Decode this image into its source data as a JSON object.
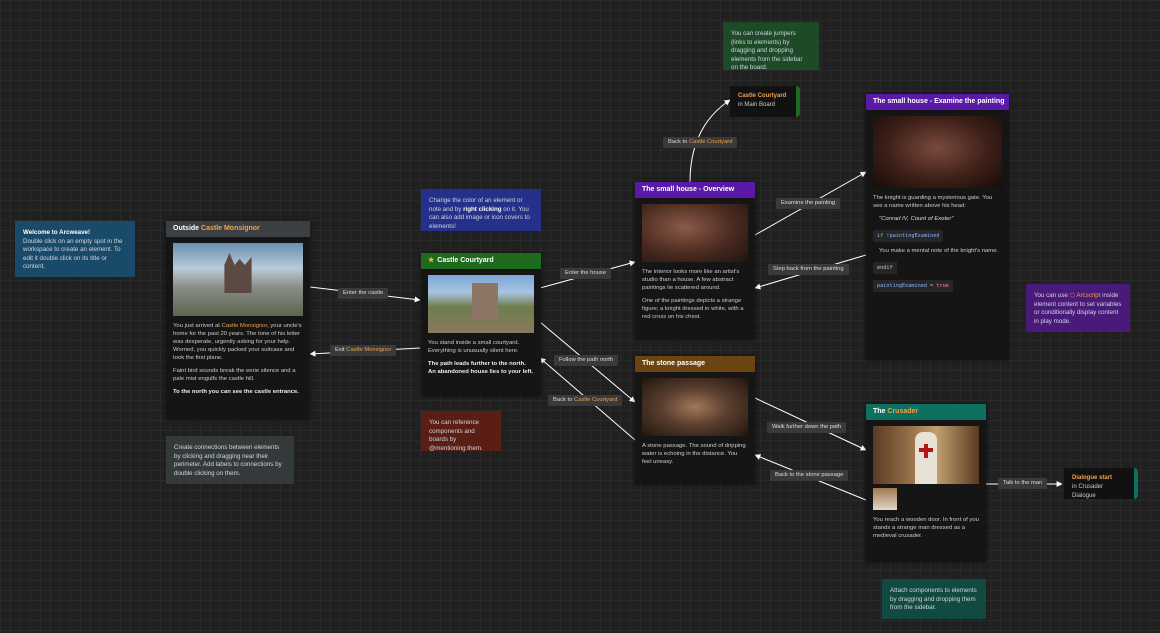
{
  "colors": {
    "canvas": "#202020",
    "accent_orange": "#f0a050",
    "header_dark": "#3b4043",
    "header_green": "#1e6b1e",
    "header_purple": "#5a1aa8",
    "header_brown": "#6b4412",
    "header_teal": "#0d7060",
    "note_blue": "#1a4a6a",
    "note_navy": "#24308a",
    "note_green": "#1e4a28",
    "note_red": "#5a1e14",
    "note_purple": "#4a1a7a",
    "note_grey": "#343a3a",
    "note_teal": "#104a40",
    "wire": "#ffffff"
  },
  "notes": {
    "welcome": {
      "title": "Welcome to Arcweave!",
      "body": "Double click on an empty spot in the workspace to create an element. To edit it double click on its title or content."
    },
    "jumpers": {
      "body": "You can create jumpers (links to elements) by dragging and dropping elements from the sidebar on the board."
    },
    "color": {
      "before": "Change the color of an element or note and by ",
      "bold": "right clicking",
      "after": " on it. You can also add image or icon covers to elements!"
    },
    "mention": {
      "body": "You can reference components and boards by @mentioning them."
    },
    "connections": {
      "body": "Create connections between elements by clicking and dragging near their perimeter. Add labels to connections by double clicking on them."
    },
    "arcscript": {
      "before": "You can use ",
      "icon": "arcscript-icon",
      "link": "Arcscript",
      "after": " inside element content to set variables or conditionally display content in play mode."
    },
    "components": {
      "body": "Attach components to elements by dragging and dropping them from the sidebar."
    }
  },
  "cards": {
    "outside": {
      "title_prefix": "Outside ",
      "title_highlight": "Castle Monsignor",
      "p1_before": "You just arrived at ",
      "p1_highlight": "Castle Monsignor",
      "p1_after": ", your uncle's home for the past 20 years. The tone of his letter was desperate, urgently asking for your help. Worried, you quickly packed your suitcase and took the first plane.",
      "p2": "Faint bird sounds break the eerie silence and a pale mist engulfs the castle hill.",
      "p3": "To the north you can see the castle entrance."
    },
    "courtyard": {
      "icon": "star-icon",
      "title": "Castle Courtyard",
      "p1": "You stand inside a small courtyard. Everything is unusually silent here.",
      "p2": "The path leads further to the north. An abandoned house lies to your left."
    },
    "overview": {
      "title": "The small house - Overview",
      "p1": "The interior looks more like an artist's studio than a house. A few abstract paintings lie scattered around.",
      "p2": "One of the paintings depicts a strange figure; a knight dressed in white, with a red cross on his chest."
    },
    "painting": {
      "title": "The small house - Examine the painting",
      "p1": "The knight is guarding a mysterious gate. You see a name written above his head:",
      "quote": "\"Conrad IV, Count of Exeter\"",
      "code1_kw": "if",
      "code1_var": "!paintingExamined",
      "p2": "You make a mental note of the knight's name.",
      "code2": "endif",
      "code3_var": "paintingExamined",
      "code3_op": "=",
      "code3_val": "true"
    },
    "passage": {
      "title": "The stone passage",
      "p1": "A stone passage. The sound of dripping water is echoing in the distance. You feel uneasy."
    },
    "crusader": {
      "title_prefix": "The ",
      "title_highlight": "Crusader",
      "p1": "You reach a wooden door. In front of you stands a strange man dressed as a medieval crusader."
    }
  },
  "jumpers": {
    "courtyard": {
      "title": "Castle Courtyard",
      "sub": "in Main Board"
    },
    "dialogue": {
      "title": "Dialogue start",
      "sub": "in Crusader Dialogue"
    }
  },
  "labels": {
    "enter_castle": "Enter the castle",
    "exit_castle_prefix": "Exit ",
    "exit_castle_highlight": "Castle Monsignor",
    "enter_house": "Enter the house",
    "follow_path": "Follow the path north",
    "back_courtyard1_prefix": "Back to ",
    "back_courtyard1_highlight": "Castle Courtyard",
    "back_courtyard2_prefix": "Back to ",
    "back_courtyard2_highlight": "Castle Courtyard",
    "examine": "Examine the painting",
    "step_back": "Step back from the painting",
    "walk_further": "Walk further down the path",
    "back_passage": "Back to the stone passage",
    "talk": "Talk to the man"
  }
}
